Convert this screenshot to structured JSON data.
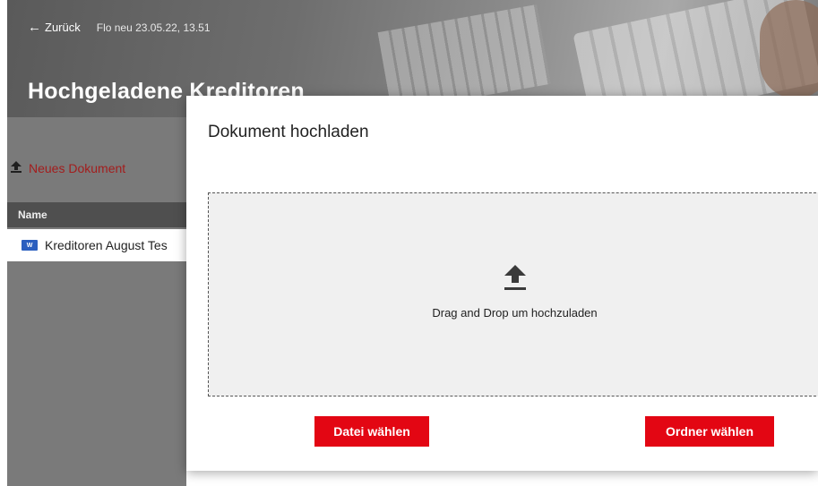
{
  "header": {
    "back_label": "Zurück",
    "breadcrumb": "Flo neu 23.05.22, 13.51",
    "title": "Hochgeladene Kreditoren"
  },
  "sidebar": {
    "new_document_label": "Neues Dokument",
    "table": {
      "column_name": "Name",
      "rows": [
        {
          "name": "Kreditoren August Tes",
          "icon": "word-document-icon"
        }
      ]
    }
  },
  "modal": {
    "title": "Dokument hochladen",
    "dropzone_text": "Drag and Drop um hochzuladen",
    "choose_file_label": "Datei wählen",
    "choose_folder_label": "Ordner wählen"
  },
  "colors": {
    "accent": "#e30613",
    "link": "#a31d1d",
    "dropzone_bg": "#f0f0f0"
  }
}
